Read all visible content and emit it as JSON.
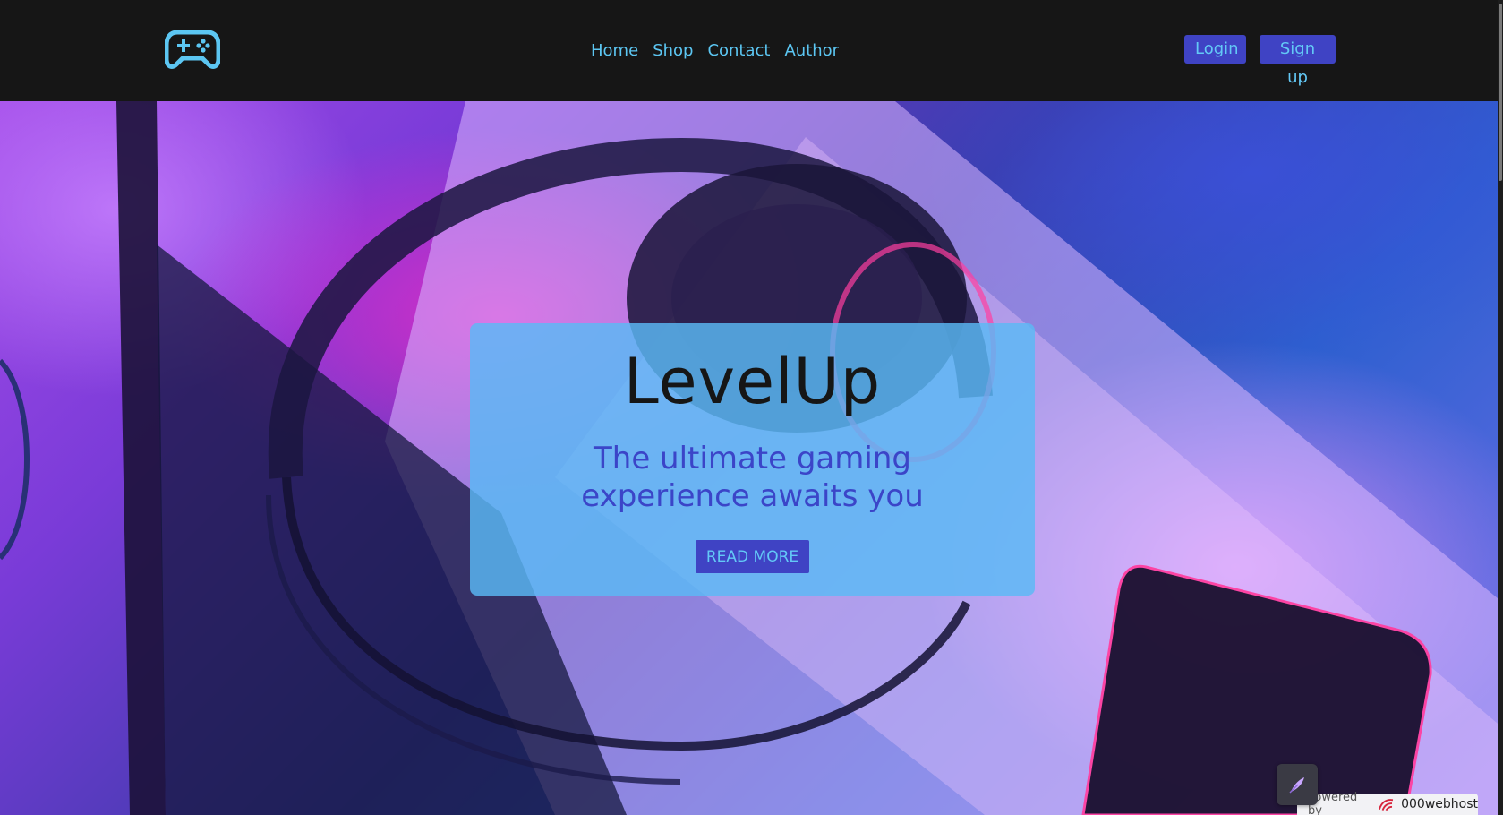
{
  "navbar": {
    "logo_icon": "gamepad-icon",
    "links": [
      "Home",
      "Shop",
      "Contact",
      "Author"
    ],
    "login_label": "Login",
    "signup_label": "Sign up"
  },
  "hero": {
    "title": "LevelUp",
    "subtitle": "The ultimate gaming experience awaits you",
    "cta_label": "READ MORE"
  },
  "widgets": {
    "feather_icon": "feather-icon",
    "powered_prefix": "Powered by",
    "powered_brand": "000webhost"
  },
  "colors": {
    "navbar_bg": "#161616",
    "accent_button": "#3f43c4",
    "link_color": "#5cc6f2",
    "card_bg": "#5ab9f5"
  }
}
